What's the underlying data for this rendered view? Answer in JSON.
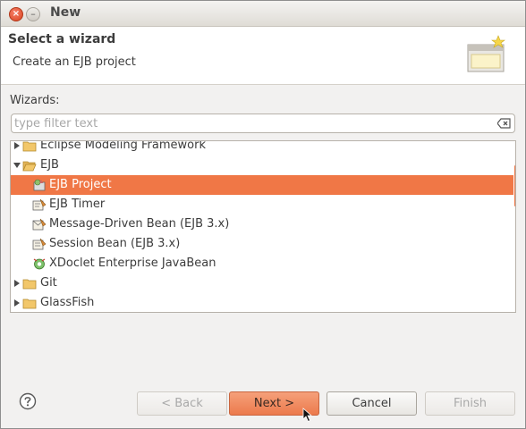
{
  "window": {
    "title": "New",
    "close_glyph": "×",
    "minimize_glyph": "–"
  },
  "header": {
    "title": "Select a wizard",
    "description": "Create an EJB project",
    "icon": "wizard-banner-icon"
  },
  "wizards_label": "Wizards:",
  "filter": {
    "value": "",
    "placeholder": "type filter text",
    "clear_icon": "clear-text-icon"
  },
  "tree": {
    "items": [
      {
        "label": "Eclipse Modeling Framework",
        "kind": "folder",
        "expanded": false
      },
      {
        "label": "EJB",
        "kind": "folder",
        "expanded": true
      },
      {
        "label": "EJB Project",
        "kind": "ejb-project",
        "selected": true
      },
      {
        "label": "EJB Timer",
        "kind": "ejb-item"
      },
      {
        "label": "Message-Driven Bean (EJB 3.x)",
        "kind": "ejb-item"
      },
      {
        "label": "Session Bean (EJB 3.x)",
        "kind": "ejb-item"
      },
      {
        "label": "XDoclet Enterprise JavaBean",
        "kind": "xdoclet"
      },
      {
        "label": "Git",
        "kind": "folder",
        "expanded": false
      },
      {
        "label": "GlassFish",
        "kind": "folder",
        "expanded": false
      }
    ]
  },
  "buttons": {
    "back": "< Back",
    "next": "Next >",
    "cancel": "Cancel",
    "finish": "Finish"
  },
  "colors": {
    "selection": "#f07746",
    "primary_button": "#ec7a4c",
    "close_button": "#d9441f"
  }
}
